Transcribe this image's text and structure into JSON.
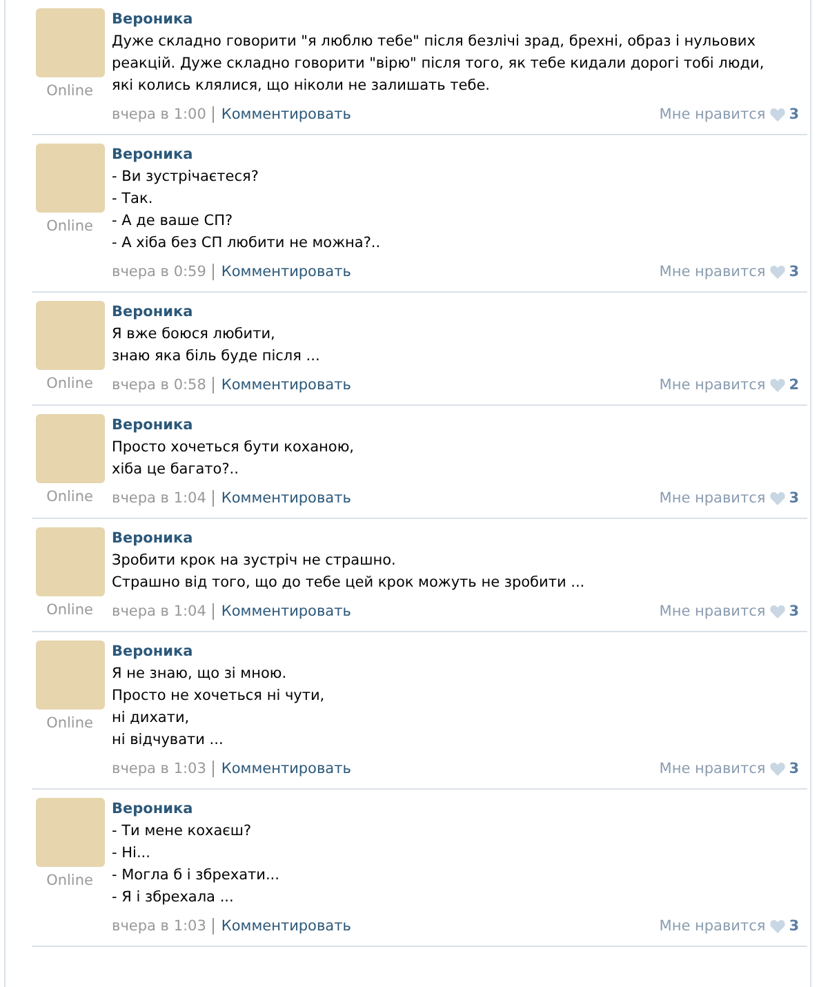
{
  "posts": [
    {
      "author": "Вероника",
      "status": "Online",
      "lines": [
        "Дуже складно говорити \"я люблю тебе\" після безлічі зрад, брехні, образ і нульових реакцій. Дуже складно говорити \"вірю\" після того, як тебе кидали дорогі тобі люди, які колись клялися, що ніколи не залишать тебе."
      ],
      "time": "вчера в 1:00",
      "comment_link": "Комментировать",
      "like_label": "Мне нравится",
      "likes": "3"
    },
    {
      "author": "Вероника",
      "status": "Online",
      "lines": [
        "- Ви зустрічаєтеся?",
        "- Так.",
        "- А де ваше СП?",
        "- А хіба без СП любити не можна?.."
      ],
      "time": "вчера в 0:59",
      "comment_link": "Комментировать",
      "like_label": "Мне нравится",
      "likes": "3"
    },
    {
      "author": "Вероника",
      "status": "Online",
      "lines": [
        "Я вже боюся любити,",
        "знаю яка біль буде після ..."
      ],
      "time": "вчера в 0:58",
      "comment_link": "Комментировать",
      "like_label": "Мне нравится",
      "likes": "2"
    },
    {
      "author": "Вероника",
      "status": "Online",
      "lines": [
        "Просто хочеться бути коханою,",
        "хіба це багато?.."
      ],
      "time": "вчера в 1:04",
      "comment_link": "Комментировать",
      "like_label": "Мне нравится",
      "likes": "3"
    },
    {
      "author": "Вероника",
      "status": "Online",
      "lines": [
        "Зробити крок на зустріч не страшно.",
        "Страшно від того, що до тебе цей крок можуть не зробити ..."
      ],
      "time": "вчера в 1:04",
      "comment_link": "Комментировать",
      "like_label": "Мне нравится",
      "likes": "3"
    },
    {
      "author": "Вероника",
      "status": "Online",
      "lines": [
        "Я не знаю, що зі мною.",
        "Просто не хочеться ні чути,",
        "ні дихати,",
        "ні відчувати ..."
      ],
      "time": "вчера в 1:03",
      "comment_link": "Комментировать",
      "like_label": "Мне нравится",
      "likes": "3"
    },
    {
      "author": "Вероника",
      "status": "Online",
      "lines": [
        "- Ти мене кохаєш?",
        "- Ні...",
        "- Могла б і збрехати...",
        "- Я і збрехала ..."
      ],
      "time": "вчера в 1:03",
      "comment_link": "Комментировать",
      "like_label": "Мне нравится",
      "likes": "3"
    }
  ]
}
